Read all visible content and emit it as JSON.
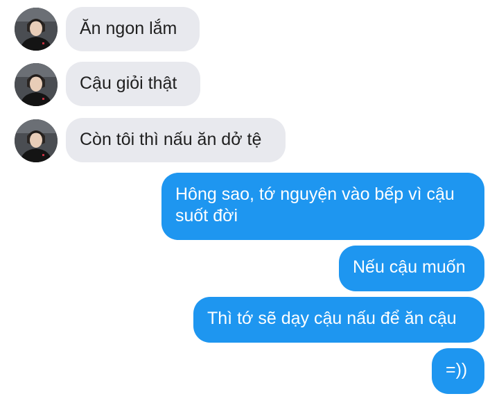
{
  "conversation": {
    "incoming": [
      {
        "text": "Ăn ngon lắm"
      },
      {
        "text": "Cậu giỏi thật"
      },
      {
        "text": "Còn tôi thì nấu ăn dở tệ"
      }
    ],
    "outgoing": [
      {
        "line1": "Hông sao, tớ nguyện vào bếp vì cậu",
        "line2": "suốt đời"
      },
      {
        "text": "Nếu cậu muốn"
      },
      {
        "text": "Thì tớ sẽ dạy cậu nấu để ăn cậu"
      },
      {
        "text": "=))"
      }
    ]
  },
  "colors": {
    "incoming_bubble": "#e8e9ee",
    "outgoing_bubble": "#1e96f0",
    "outgoing_text": "#ffffff",
    "incoming_text": "#1f1f1f"
  },
  "icons": {
    "avatar": "contact-avatar"
  }
}
